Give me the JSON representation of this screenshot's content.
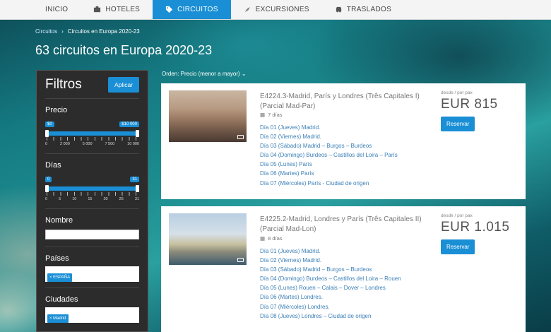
{
  "nav": {
    "items": [
      {
        "label": "INICIO",
        "icon": ""
      },
      {
        "label": "HOTELES",
        "icon": "hotel-icon"
      },
      {
        "label": "CIRCUITOS",
        "icon": "tag-icon"
      },
      {
        "label": "EXCURSIONES",
        "icon": "compass-icon"
      },
      {
        "label": "TRASLADOS",
        "icon": "car-icon"
      }
    ],
    "active": "CIRCUITOS"
  },
  "breadcrumb": {
    "link": "Circuitos",
    "separator": "›",
    "current": "Circuitos en Europa 2020-23"
  },
  "page_title": "63 circuitos en Europa 2020-23",
  "sort_label": "Orden: Precio (menor a mayor) ⌄",
  "filters": {
    "title": "Filtros",
    "apply_label": "Aplicar",
    "price": {
      "label": "Precio",
      "min_badge": "$0",
      "max_badge": "$10 000",
      "ticks": [
        "0",
        "2 000",
        "5 000",
        "7 500",
        "10 000"
      ]
    },
    "days": {
      "label": "Días",
      "min_badge": "0",
      "max_badge": "31",
      "ticks": [
        "0",
        "5",
        "10",
        "15",
        "20",
        "25",
        "31"
      ]
    },
    "name": {
      "label": "Nombre",
      "value": ""
    },
    "countries": {
      "label": "Países",
      "tag": "× ESPAÑA"
    },
    "cities": {
      "label": "Ciudades",
      "tag": "× Madrid"
    }
  },
  "tours": [
    {
      "title": "E4224.3-Madrid, París y Londres (Três Capitales I) (Parcial Mad-Par)",
      "duration": "7 días",
      "itinerary": [
        "Día 01 (Jueves) Madrid.",
        "Día 02 (Viernes) Madrid.",
        "Día 03 (Sábado) Madrid – Burgos – Burdeos",
        "Día 04 (Domingo) Burdeos – Castillos del Loira – París",
        "Día 05 (Lunes) París",
        "Día 06 (Martes) París",
        "Día 07 (Miércoles) París - Ciudad de origen"
      ],
      "price_label": "desde / por pax",
      "price": "EUR 815",
      "button": "Reservar"
    },
    {
      "title": "E4225.2-Madrid, Londres y París (Três Capitales II) (Parcial Mad-Lon)",
      "duration": "8 días",
      "itinerary": [
        "Día 01 (Jueves) Madrid.",
        "Día 02 (Viernes) Madrid.",
        "Día 03 (Sábado) Madrid – Burgos – Burdeos",
        "Día 04 (Domingo) Burdeos – Castillos del Loira – Rouen",
        "Día 05 (Lunes) Rouen – Calais – Dover – Londres",
        "Día 06 (Martes) Londres.",
        "Día 07 (Miércoles) Londres.",
        "Día 08 (Jueves) Londres – Ciudad de origen"
      ],
      "price_label": "desde / por pax",
      "price": "EUR 1.015",
      "button": "Reservar"
    }
  ]
}
